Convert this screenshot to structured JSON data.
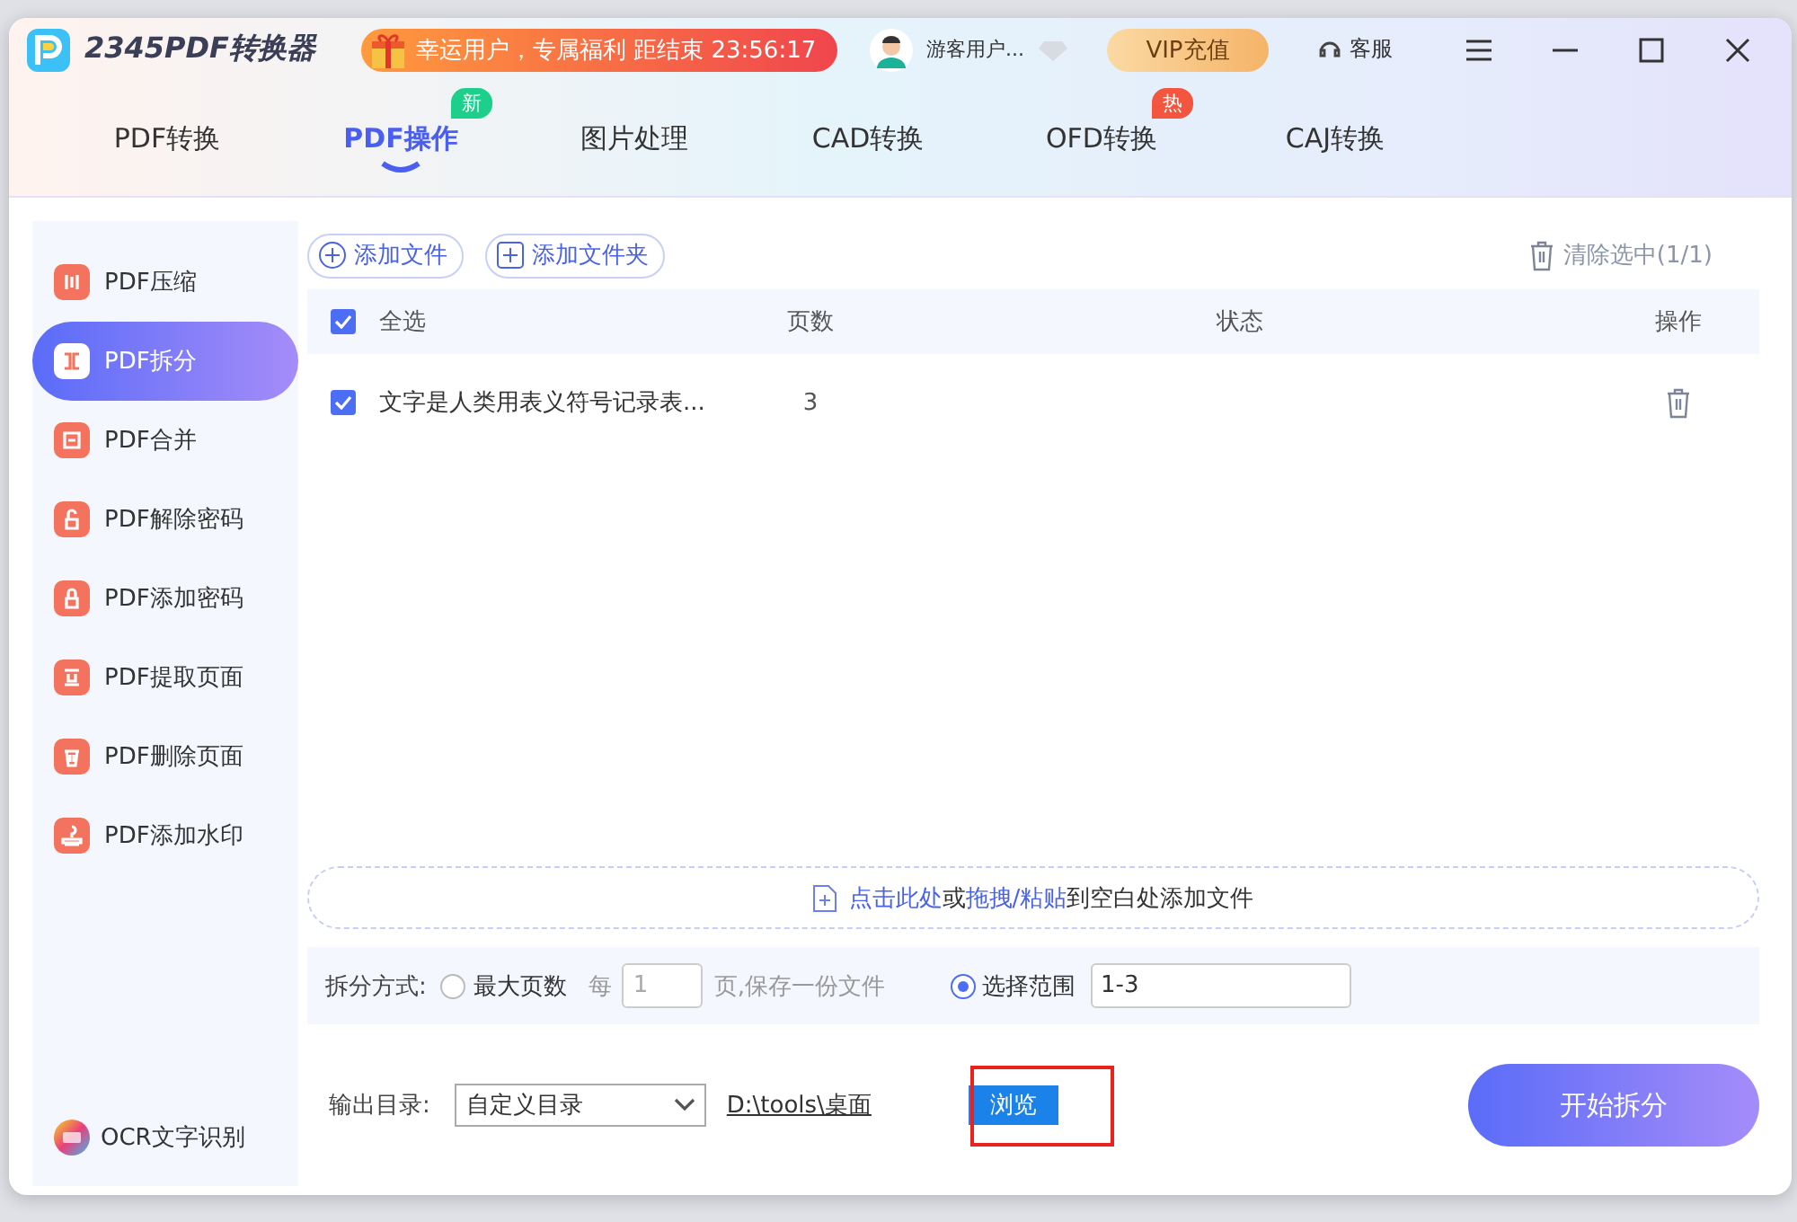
{
  "app": {
    "name": "2345PDF转换器"
  },
  "promo": {
    "text": "幸运用户，专属福利 距结束 23:56:17"
  },
  "account": {
    "user": "游客用户...",
    "vip": "VIP充值",
    "service": "客服"
  },
  "tabs": [
    {
      "label": "PDF转换",
      "selected": false
    },
    {
      "label": "PDF操作",
      "selected": true,
      "badge": "新",
      "color": "#1ccf8a"
    },
    {
      "label": "图片处理",
      "selected": false
    },
    {
      "label": "CAD转换",
      "selected": false
    },
    {
      "label": "OFD转换",
      "selected": false,
      "badge": "热",
      "color": "#f4553f"
    },
    {
      "label": "CAJ转换",
      "selected": false
    }
  ],
  "sidebar": {
    "items": [
      {
        "label": "PDF压缩",
        "selected": false
      },
      {
        "label": "PDF拆分",
        "selected": true
      },
      {
        "label": "PDF合并",
        "selected": false
      },
      {
        "label": "PDF解除密码",
        "selected": false
      },
      {
        "label": "PDF添加密码",
        "selected": false
      },
      {
        "label": "PDF提取页面",
        "selected": false
      },
      {
        "label": "PDF删除页面",
        "selected": false
      },
      {
        "label": "PDF添加水印",
        "selected": false
      }
    ],
    "footer": "OCR文字识别"
  },
  "toolbar": {
    "add_file": "添加文件",
    "add_folder": "添加文件夹",
    "clear": "清除选中(1/1)"
  },
  "table": {
    "select_all": {
      "label": "全选",
      "checked": true
    },
    "columns": [
      "页数",
      "状态",
      "操作"
    ],
    "rows": [
      {
        "name": "文字是人类用表义符号记录表...",
        "pages": "3",
        "checked": true
      }
    ]
  },
  "drop_zone": {
    "parts": [
      {
        "text": "点击此处",
        "kind": "link"
      },
      {
        "text": "或",
        "kind": "plain"
      },
      {
        "text": "拖拽/粘贴",
        "kind": "link"
      },
      {
        "text": "到空白处添加文件",
        "kind": "plain"
      }
    ]
  },
  "split": {
    "label": "拆分方式:",
    "max_pages": {
      "label": "最大页数",
      "selected": false
    },
    "per": "每",
    "per_value": "1",
    "per_suffix": "页,保存一份文件",
    "range": {
      "label": "选择范围",
      "selected": true
    },
    "range_value": "1-3"
  },
  "output": {
    "label": "输出目录:",
    "select": "自定义目录",
    "path": "D:\\tools\\桌面",
    "browse": "浏览",
    "browse_highlighted": true,
    "start": "开始拆分"
  }
}
